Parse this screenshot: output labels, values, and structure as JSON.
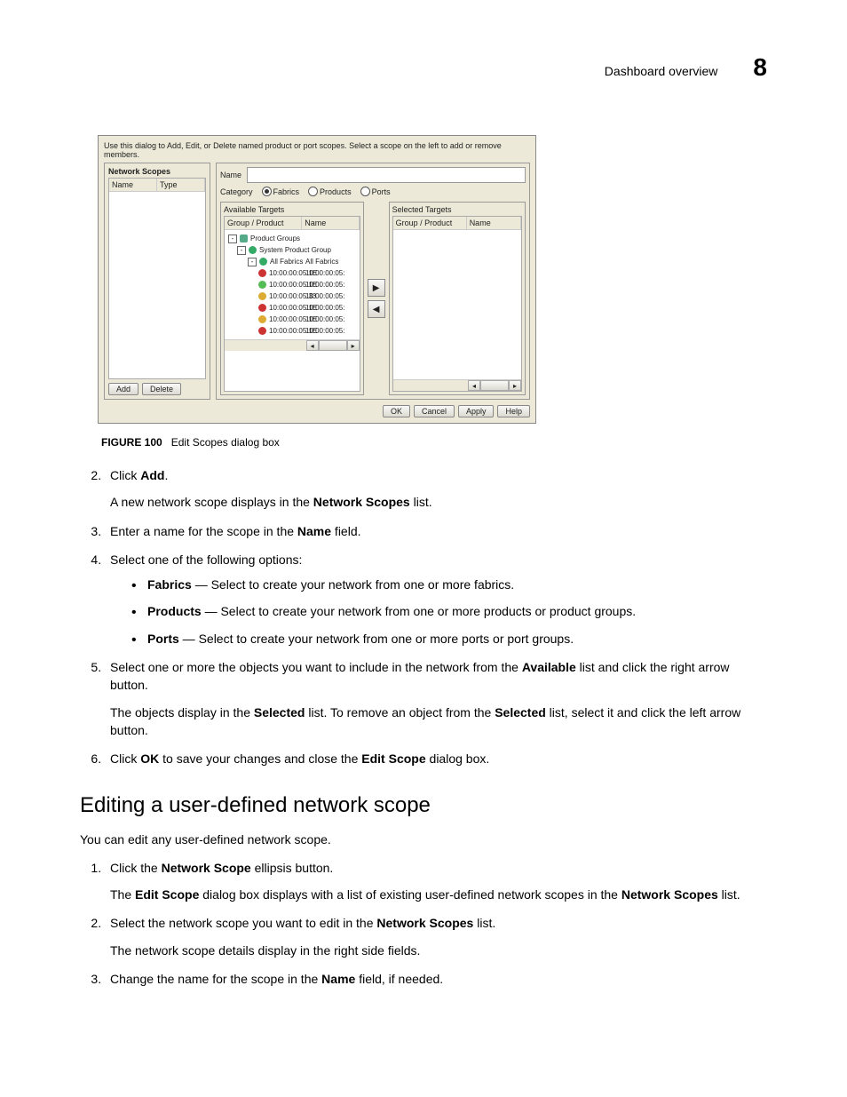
{
  "header": {
    "section": "Dashboard overview",
    "chapter": "8"
  },
  "dialog": {
    "intro": "Use this dialog to Add, Edit, or Delete named product or port scopes. Select a scope on the left to add or remove members.",
    "network_scopes": {
      "title": "Network Scopes",
      "col_name": "Name",
      "col_type": "Type"
    },
    "add_btn": "Add",
    "delete_btn": "Delete",
    "name_label": "Name",
    "category_label": "Category",
    "category_opts": {
      "fabrics": "Fabrics",
      "products": "Products",
      "ports": "Ports"
    },
    "available": {
      "title": "Available Targets",
      "col1": "Group / Product",
      "col2": "Name"
    },
    "selected": {
      "title": "Selected Targets",
      "col1": "Group / Product",
      "col2": "Name"
    },
    "tree": {
      "root": "Product Groups",
      "g1": "System Product Group",
      "g2": "All Fabrics",
      "g2v": "All Fabrics",
      "r1a": "10:00:00:05:1E",
      "r1b": "10:00:00:05:",
      "r2a": "10:00:00:05:1E",
      "r2b": "10:00:00:05:",
      "r3a": "10:00:00:05:33",
      "r3b": "10:00:00:05:",
      "r4a": "10:00:00:05:1E",
      "r4b": "10:00:00:05:",
      "r5a": "10:00:00:05:1E",
      "r5b": "10:00:00:05:",
      "r6a": "10:00:00:05:1E",
      "r6b": "10:00:00:05:"
    },
    "arrows": {
      "right": "▶",
      "left": "◀"
    },
    "scroll": {
      "left": "◂",
      "right": "▸"
    },
    "ok": "OK",
    "cancel": "Cancel",
    "apply": "Apply",
    "help": "Help"
  },
  "figure": {
    "label": "FIGURE 100",
    "caption": "Edit Scopes dialog box"
  },
  "steps1": {
    "item2_a": "Click ",
    "item2_b": "Add",
    "item2_c": ".",
    "item2_p_a": "A new network scope displays in the ",
    "item2_p_b": "Network Scopes",
    "item2_p_c": " list.",
    "item3_a": "Enter a name for the scope in the ",
    "item3_b": "Name",
    "item3_c": " field.",
    "item4": "Select one of the following options:",
    "opt1_a": "Fabrics",
    "opt1_b": " — Select to create your network from one or more fabrics.",
    "opt2_a": "Products",
    "opt2_b": " — Select to create your network from one or more products or product groups.",
    "opt3_a": "Ports",
    "opt3_b": " — Select to create your network from one or more ports or port groups.",
    "item5_a": "Select one or more the objects you want to include in the network from the ",
    "item5_b": "Available",
    "item5_c": " list and click the right arrow button.",
    "item5_p_a": "The objects display in the ",
    "item5_p_b": "Selected",
    "item5_p_c": " list. To remove an object from the ",
    "item5_p_d": "Selected",
    "item5_p_e": " list, select it and click the left arrow button.",
    "item6_a": "Click ",
    "item6_b": "OK",
    "item6_c": " to save your changes and close the ",
    "item6_d": "Edit Scope",
    "item6_e": " dialog box."
  },
  "h2": "Editing a user-defined network scope",
  "intro2": "You can edit any user-defined network scope.",
  "steps2": {
    "item1_a": "Click the ",
    "item1_b": "Network Scope",
    "item1_c": " ellipsis button.",
    "item1_p_a": "The ",
    "item1_p_b": "Edit Scope",
    "item1_p_c": " dialog box displays with a list of existing user-defined network scopes in the ",
    "item1_p_d": "Network Scopes",
    "item1_p_e": " list.",
    "item2_a": "Select the network scope you want to edit in the ",
    "item2_b": "Network Scopes",
    "item2_c": " list.",
    "item2_p": "The network scope details display in the right side fields.",
    "item3_a": "Change the name for the scope in the ",
    "item3_b": "Name",
    "item3_c": " field, if needed."
  }
}
